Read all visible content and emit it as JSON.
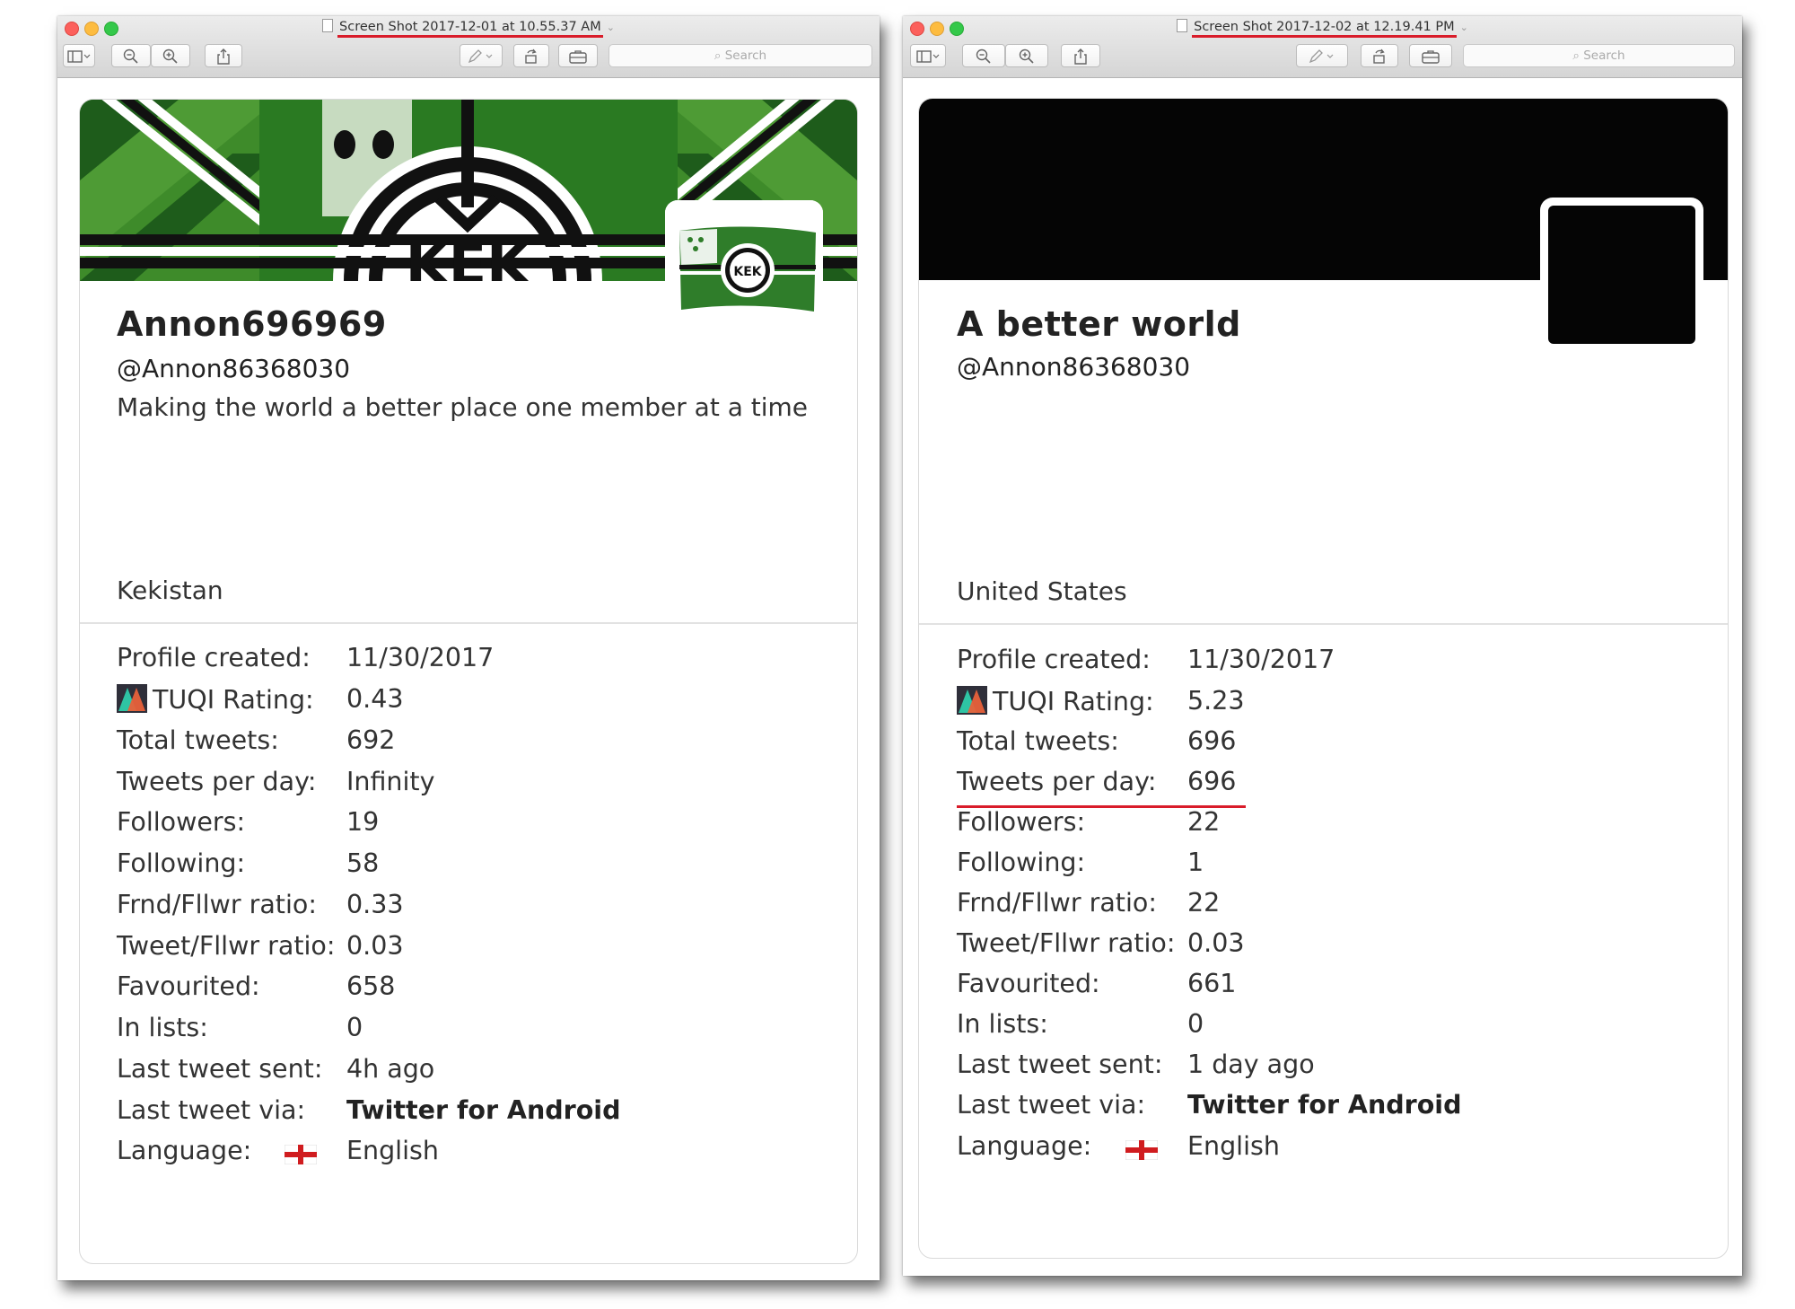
{
  "windows": [
    {
      "title": "Screen Shot 2017-12-01 at 10.55.37 AM",
      "search_placeholder": "Search",
      "profile": {
        "display_name": "Annon696969",
        "handle": "@Annon86368030",
        "bio": "Making the world a better place one member at a time",
        "location": "Kekistan",
        "stats": [
          {
            "label": "Profile created:",
            "value": "11/30/2017"
          },
          {
            "label": "TUQI Rating:",
            "value": "0.43"
          },
          {
            "label": "Total tweets:",
            "value": "692"
          },
          {
            "label": "Tweets per day:",
            "value": "Infinity"
          },
          {
            "label": "Followers:",
            "value": "19"
          },
          {
            "label": "Following:",
            "value": "58"
          },
          {
            "label": "Frnd/Fllwr ratio:",
            "value": "0.33"
          },
          {
            "label": "Tweet/Fllwr ratio:",
            "value": "0.03"
          },
          {
            "label": "Favourited:",
            "value": "658"
          },
          {
            "label": "In lists:",
            "value": "0"
          },
          {
            "label": "Last tweet sent:",
            "value": "4h ago"
          },
          {
            "label": "Last tweet via:",
            "value": "Twitter for Android"
          },
          {
            "label": "Language:",
            "value": "English"
          }
        ]
      }
    },
    {
      "title": "Screen Shot 2017-12-02 at 12.19.41 PM",
      "search_placeholder": "Search",
      "profile": {
        "display_name": "A better world",
        "handle": "@Annon86368030",
        "bio": "",
        "location": "United States",
        "stats": [
          {
            "label": "Profile created:",
            "value": "11/30/2017"
          },
          {
            "label": "TUQI Rating:",
            "value": "5.23"
          },
          {
            "label": "Total tweets:",
            "value": "696"
          },
          {
            "label": "Tweets per day:",
            "value": "696"
          },
          {
            "label": "Followers:",
            "value": "22"
          },
          {
            "label": "Following:",
            "value": "1"
          },
          {
            "label": "Frnd/Fllwr ratio:",
            "value": "22"
          },
          {
            "label": "Tweet/Fllwr ratio:",
            "value": "0.03"
          },
          {
            "label": "Favourited:",
            "value": "661"
          },
          {
            "label": "In lists:",
            "value": "0"
          },
          {
            "label": "Last tweet sent:",
            "value": "1 day ago"
          },
          {
            "label": "Last tweet via:",
            "value": "Twitter for Android"
          },
          {
            "label": "Language:",
            "value": "English"
          }
        ]
      }
    }
  ],
  "icons": {
    "sidebar": "sidebar-toggle-icon",
    "zoom_out": "zoom-out-icon",
    "zoom_in": "zoom-in-icon",
    "share": "share-icon",
    "markup": "pen-icon",
    "rotate": "rotate-icon",
    "toolbox": "toolbox-icon",
    "search": "search-icon",
    "tuqi": "tuqi-logo-icon",
    "language_flag": "england-flag-icon"
  },
  "colors": {
    "annotation_underline": "#d91c2a",
    "kek_green": "#2e7d32",
    "banner_dark": "#050505"
  }
}
